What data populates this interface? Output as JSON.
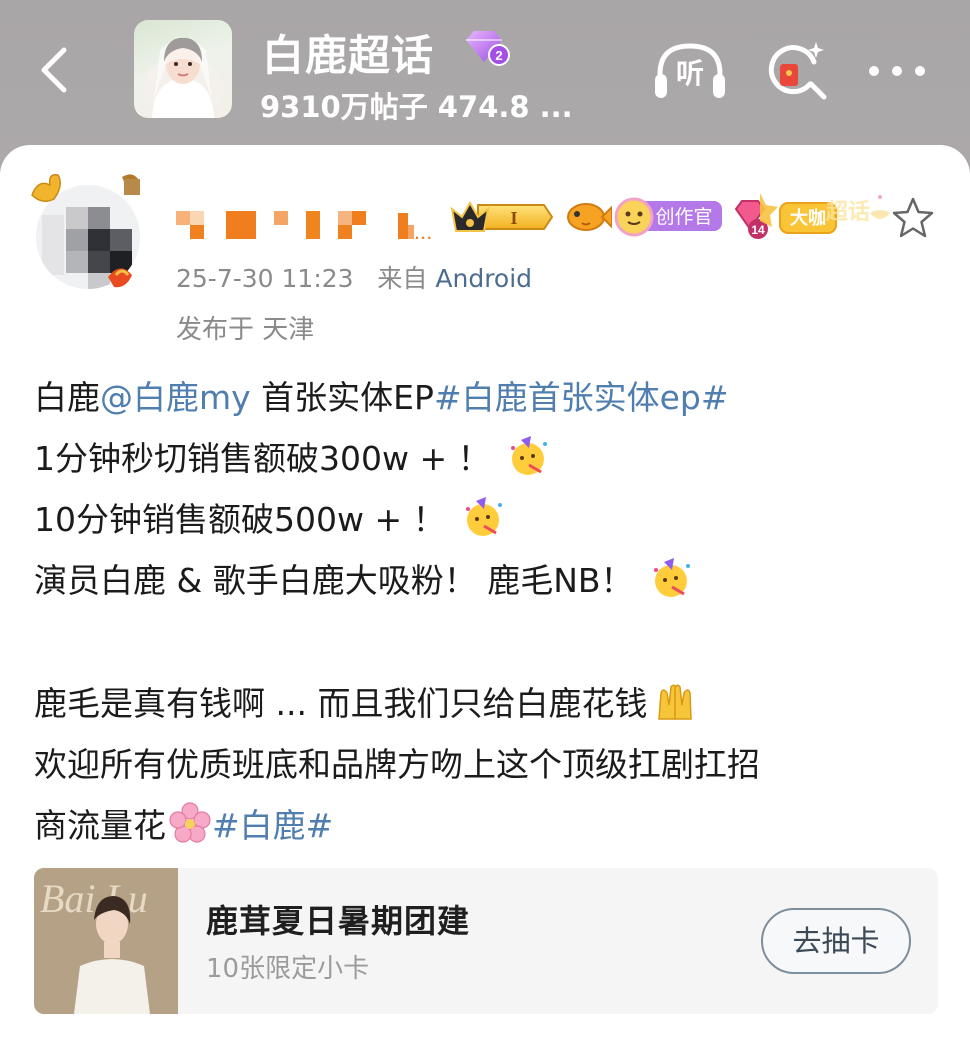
{
  "header": {
    "title": "白鹿超话",
    "badge_level": "2",
    "stats": "9310万帖子 474.8 ...",
    "listen_label": "听"
  },
  "post": {
    "username": "...",
    "badges": {
      "crown_level": "I",
      "creator_label": "创作官",
      "level_num": "14",
      "rank_label": "大咖",
      "super_label": "超话"
    },
    "date": "25-7-30 11:23",
    "from_prefix": "来自",
    "source": "Android",
    "location": "发布于 天津",
    "lines": {
      "l1_a": "白鹿",
      "l1_mention": "@白鹿my",
      "l1_b": " 首张实体EP",
      "l1_tag": "#白鹿首张实体ep#",
      "l2": "1分钟秒切销售额破300w + ！",
      "l3": "10分钟销售额破500w + ！",
      "l4": "演员白鹿 & 歌手白鹿大吸粉！ 鹿毛NB！",
      "l5": "鹿毛是真有钱啊 ... 而且我们只给白鹿花钱",
      "l6": "欢迎所有优质班底和品牌方吻上这个顶级扛剧扛招",
      "l7_a": "商流量花",
      "l7_tag": "#白鹿#"
    }
  },
  "promo": {
    "title": "鹿茸夏日暑期团建",
    "subtitle": "10张限定小卡",
    "button": "去抽卡",
    "thumb_text": "Bai Lu"
  },
  "colors": {
    "link": "#4f7eaf",
    "meta": "#8a8a8a",
    "mosaic": "#f07d1e"
  }
}
